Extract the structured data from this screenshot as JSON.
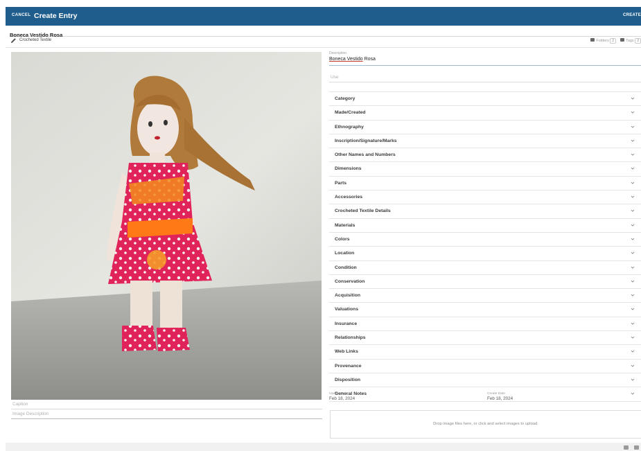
{
  "header": {
    "cancel_label": "CANCEL",
    "title": "Create Entry",
    "create_label": "CREATE",
    "color": "#1f5d8c"
  },
  "entry": {
    "name": "Boneca Vestido Rosa",
    "type": "Crocheted Textile",
    "folders_label": "Folders",
    "folders_count": "2",
    "tags_label": "Tags",
    "tags_count": "2"
  },
  "image": {
    "alt": "Doll in pink dress",
    "caption_placeholder": "Caption",
    "description_placeholder": "Image Description"
  },
  "form": {
    "description_label": "Description",
    "description_value_part1": "Boneca Vestido",
    "description_value_part2": " Rosa",
    "use_placeholder": "Use"
  },
  "sections": [
    {
      "label": "Category"
    },
    {
      "label": "Made/Created"
    },
    {
      "label": "Ethnography"
    },
    {
      "label": "Inscription/Signature/Marks"
    },
    {
      "label": "Other Names and Numbers"
    },
    {
      "label": "Dimensions"
    },
    {
      "label": "Parts"
    },
    {
      "label": "Accessories"
    },
    {
      "label": "Crocheted Textile Details"
    },
    {
      "label": "Materials"
    },
    {
      "label": "Colors"
    },
    {
      "label": "Location"
    },
    {
      "label": "Condition"
    },
    {
      "label": "Conservation"
    },
    {
      "label": "Acquisition"
    },
    {
      "label": "Valuations"
    },
    {
      "label": "Insurance"
    },
    {
      "label": "Relationships"
    },
    {
      "label": "Web Links"
    },
    {
      "label": "Provenance"
    },
    {
      "label": "Disposition"
    },
    {
      "label": "General Notes"
    }
  ],
  "dates": {
    "update_label": "Update Date",
    "update_value": "Feb 18, 2024",
    "create_label": "Create Date",
    "create_value": "Feb 18, 2024"
  },
  "upload": {
    "text": "Drop image files here, or click and select images to upload."
  },
  "icons": {
    "pencil": "pencil-icon",
    "folder": "folder-icon",
    "tag": "tag-icon",
    "chevron": "chevron-down-icon"
  }
}
